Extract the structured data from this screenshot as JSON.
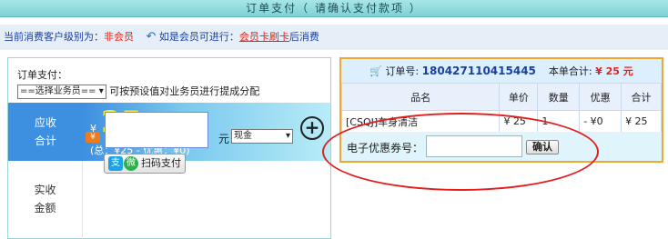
{
  "header": {
    "title": "订单支付（ 请确认支付款项 ）"
  },
  "info": {
    "level_prefix": "当前消费客户级别为：",
    "level_value": "非会员",
    "member_prefix": "如是会员可进行：",
    "member_link": "会员卡刷卡",
    "member_suffix": "后消费"
  },
  "left": {
    "title": "订单支付：",
    "staff_select": "==选择业务员==",
    "staff_hint": "可按预设值对业务员进行提成分配",
    "due_label_1": "应收",
    "due_label_2": "合计",
    "yen_symbol": "¥",
    "due_amount": "25",
    "unit": "元",
    "due_detail": "(总：¥25 - 优惠：¥0)",
    "actual_label_1": "实收",
    "actual_label_2": "金额",
    "yen_badge": "¥",
    "amount_value": "",
    "amount_unit": "元",
    "pay_method": "现金",
    "scan_pay": "扫码支付",
    "add_icon": "plus-circle-icon"
  },
  "right": {
    "order_no_label": "订单号:",
    "order_no": "180427110415445",
    "total_label": "本单合计:",
    "total_value": "¥ 25 元",
    "columns": [
      "品名",
      "单价",
      "数量",
      "优惠",
      "合计"
    ],
    "rows": [
      [
        "[CSQJ]车身清洁",
        "¥ 25",
        "1",
        "- ¥0",
        "¥ 25"
      ]
    ],
    "coupon_label": "电子优惠券号：",
    "coupon_value": "",
    "confirm_label": "确认"
  },
  "colors": {
    "accent_blue": "#3d8fe0",
    "highlight_red": "#e21e1e",
    "panel_orange": "#f0a830"
  }
}
